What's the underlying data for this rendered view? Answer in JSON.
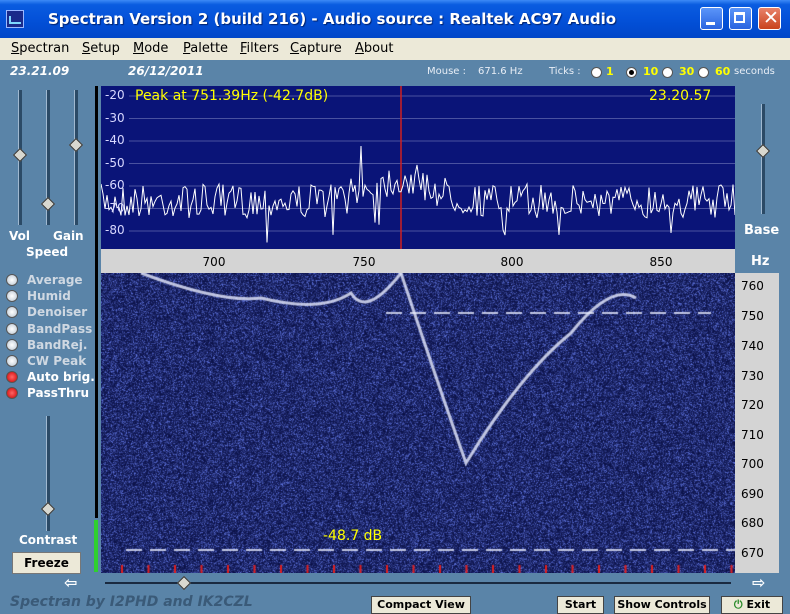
{
  "window": {
    "title": "Spectran Version 2 (build 216) - Audio source  :  Realtek AC97 Audio"
  },
  "menu": [
    "Spectran",
    "Setup",
    "Mode",
    "Palette",
    "Filters",
    "Capture",
    "About"
  ],
  "info": {
    "time": "23.21.09",
    "date": "26/12/2011",
    "mouse_label": "Mouse :",
    "mouse_value": "671.6 Hz",
    "ticks_label": "Ticks :",
    "ticks": [
      "1",
      "10",
      "30",
      "60"
    ],
    "ticks_selected": "10",
    "seconds": "seconds"
  },
  "left": {
    "vol": "Vol",
    "gain": "Gain",
    "speed": "Speed",
    "contrast": "Contrast",
    "freeze": "Freeze",
    "options": [
      {
        "label": "Average",
        "active": false
      },
      {
        "label": "Humid",
        "active": false
      },
      {
        "label": "Denoiser",
        "active": false
      },
      {
        "label": "BandPass",
        "active": false
      },
      {
        "label": "BandRej.",
        "active": false
      },
      {
        "label": "CW Peak",
        "active": false
      },
      {
        "label": "Auto brig.",
        "active": true
      },
      {
        "label": "PassThru",
        "active": true
      }
    ]
  },
  "spectrum": {
    "peak": "Peak at  751.39Hz (-42.7dB)",
    "clock": "23.20.57",
    "db_labels": [
      "-20",
      "-30",
      "-40",
      "-50",
      "-60",
      "-70",
      "-80"
    ],
    "x_ticks": [
      "700",
      "750",
      "800",
      "850"
    ]
  },
  "waterfall": {
    "y_ticks": [
      "760",
      "750",
      "740",
      "730",
      "720",
      "710",
      "700",
      "690",
      "680",
      "670"
    ],
    "db_readout": "-48.7 dB"
  },
  "right": {
    "base": "Base",
    "hz": "Hz"
  },
  "bottom": {
    "status": "Spectran  by I2PHD and IK2CZL",
    "compact": "Compact View",
    "start": "Start",
    "show_controls": "Show Controls",
    "exit": "Exit"
  },
  "colors": {
    "spectrum_bg": "#0a1478",
    "trace": "#ffffff",
    "marker": "#d02020",
    "readout": "#ffff00"
  }
}
